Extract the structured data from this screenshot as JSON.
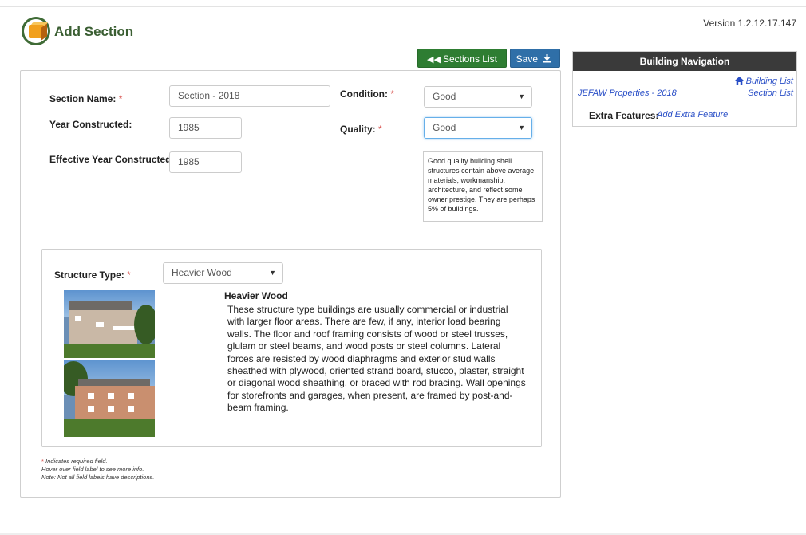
{
  "header": {
    "title": "Add Section",
    "version": "Version 1.2.12.17.147"
  },
  "toolbar": {
    "sections_list_label": "Sections List",
    "sections_list_icon": "double-left-arrow-icon",
    "save_label": "Save",
    "save_icon": "download-icon"
  },
  "form": {
    "section_name": {
      "label": "Section Name:",
      "value": "Section - 2018"
    },
    "condition": {
      "label": "Condition:",
      "value": "Good"
    },
    "year_constructed": {
      "label": "Year Constructed:",
      "value": "1985"
    },
    "quality": {
      "label": "Quality:",
      "value": "Good"
    },
    "effective_year": {
      "label": "Effective Year Constructed:",
      "value": "1985"
    },
    "quality_description": "Good quality building shell structures contain above average materials, workmanship, architecture, and reflect some owner prestige.  They are perhaps 5% of buildings.",
    "required_marker": "*"
  },
  "structure": {
    "label": "Structure Type:",
    "value": "Heavier Wood",
    "title": "Heavier Wood",
    "description": "These structure type buildings are usually commercial or industrial with larger floor areas. There are few, if any, interior load bearing walls. The floor and roof framing consists of wood or steel trusses, glulam or steel beams, and wood posts or steel columns. Lateral forces are resisted by wood diaphragms and exterior stud walls sheathed with plywood, oriented strand board, stucco, plaster, straight or diagonal wood sheathing, or braced with rod bracing. Wall openings for storefronts and garages, when present, are framed by post-and-beam framing."
  },
  "notes": {
    "required": "Indicates required field.",
    "hover": "Hover over field label to see more info.",
    "note": "Note: Not all field labels have descriptions."
  },
  "navigation": {
    "title": "Building Navigation",
    "property_link": "JEFAW Properties - 2018",
    "building_list_link": "Building List",
    "section_list_link": "Section List",
    "extra_features_label": "Extra Features:",
    "add_extra_feature_link": "Add Extra Feature"
  },
  "colors": {
    "brand_green": "#3a5e32",
    "sections_button": "#2e7d32",
    "save_button": "#2f6fa8",
    "nav_header": "#3a3a3a",
    "link": "#2a4fc7",
    "required": "#d9534f"
  }
}
